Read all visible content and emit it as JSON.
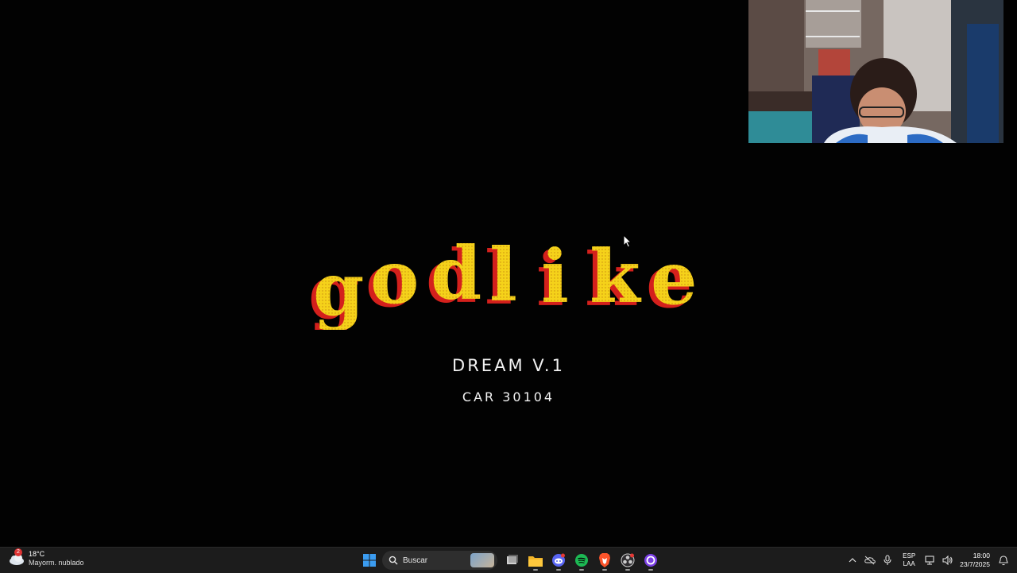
{
  "stream": {
    "logo_text": "godlike",
    "line1": "DREAM V.1",
    "line2": "CAR 30104"
  },
  "taskbar": {
    "weather": {
      "badge": "2",
      "temperature": "18°C",
      "condition": "Mayorm. nublado"
    },
    "search_placeholder": "Buscar",
    "pinned": [
      {
        "name": "start-button",
        "icon": "windows-logo"
      },
      {
        "name": "task-view-button",
        "icon": "task-view"
      },
      {
        "name": "file-explorer-button",
        "icon": "folder"
      },
      {
        "name": "discord-button",
        "icon": "discord"
      },
      {
        "name": "spotify-button",
        "icon": "spotify"
      },
      {
        "name": "brave-button",
        "icon": "brave-lion"
      },
      {
        "name": "obs-button",
        "icon": "obs"
      },
      {
        "name": "cortana-button",
        "icon": "circle"
      }
    ],
    "tray": {
      "language_top": "ESP",
      "language_bottom": "LAA",
      "time": "18:00",
      "date": "23/7/2025"
    }
  },
  "colors": {
    "logo_fill": "#f5d21a",
    "logo_shadow": "#d4201c",
    "taskbar_bg": "#1c1c1c",
    "accent_blue": "#3b9cf0"
  }
}
